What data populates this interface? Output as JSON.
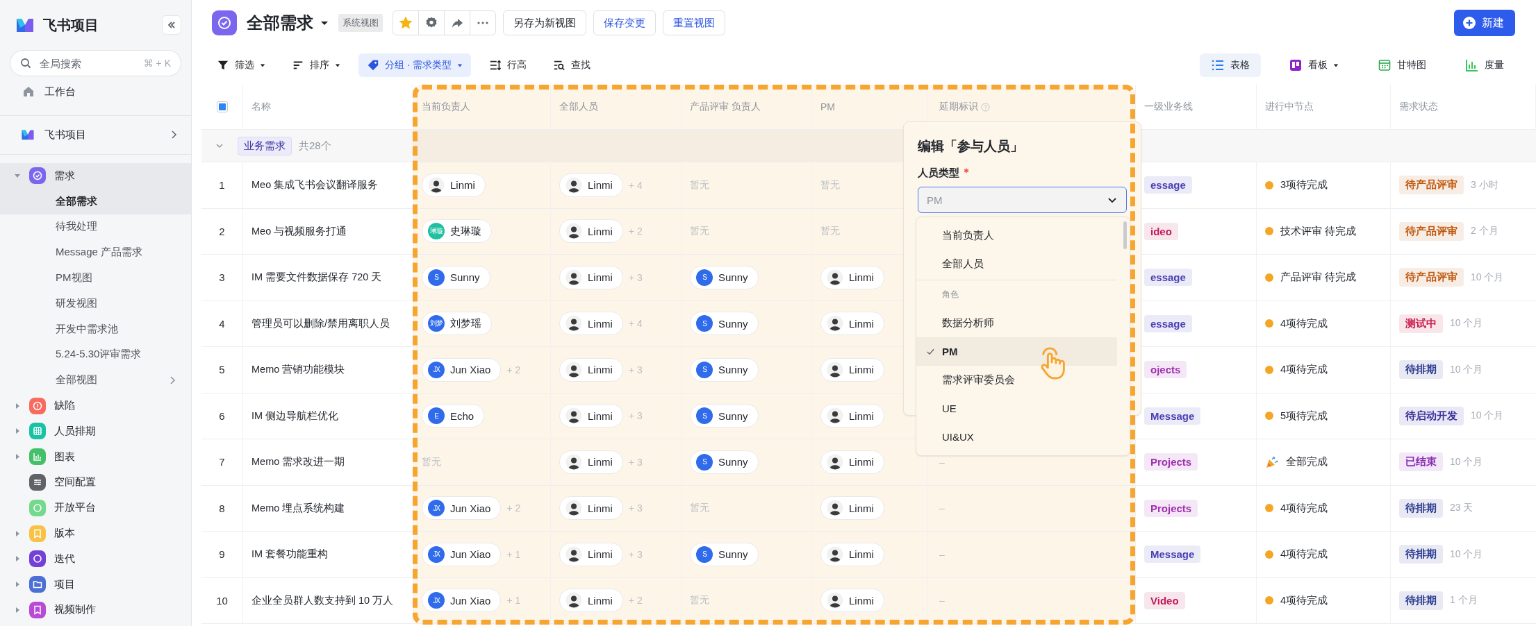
{
  "sidebar": {
    "app_name": "飞书项目",
    "search": {
      "placeholder": "全局搜索",
      "shortcut": "⌘ + K"
    },
    "home": "工作台",
    "space": "飞书项目",
    "nav": [
      {
        "label": "需求",
        "kind": "folder",
        "color": "#7b67ee",
        "expanded": true,
        "selected": true,
        "children": [
          {
            "label": "全部需求",
            "kind": "view",
            "selected": true
          },
          {
            "label": "待我处理",
            "kind": "view",
            "selected": false
          },
          {
            "label": "Message 产品需求",
            "kind": "view",
            "selected": false
          },
          {
            "label": "PM视图",
            "kind": "view",
            "selected": false
          },
          {
            "label": "研发视图",
            "kind": "view",
            "selected": false
          },
          {
            "label": "开发中需求池",
            "kind": "view",
            "selected": false
          },
          {
            "label": "5.24-5.30评审需求",
            "kind": "view",
            "selected": false
          },
          {
            "label": "全部视图",
            "kind": "more",
            "selected": false
          }
        ]
      },
      {
        "label": "缺陷",
        "kind": "folder",
        "color": "#f76c5e",
        "expanded": false,
        "selected": false
      },
      {
        "label": "人员排期",
        "kind": "folder",
        "color": "#19c2a4",
        "expanded": false,
        "selected": false
      },
      {
        "label": "图表",
        "kind": "folder",
        "color": "#45c06a",
        "expanded": false,
        "selected": false
      },
      {
        "label": "空间配置",
        "kind": "page",
        "color": "#5f6368",
        "selected": false
      },
      {
        "label": "开放平台",
        "kind": "page",
        "color": "#74d98c",
        "selected": false
      },
      {
        "label": "版本",
        "kind": "folder",
        "color": "#f7c247",
        "expanded": false,
        "selected": false
      },
      {
        "label": "迭代",
        "kind": "folder",
        "color": "#7440d6",
        "expanded": false,
        "selected": false
      },
      {
        "label": "项目",
        "kind": "folder",
        "color": "#4c6fd6",
        "expanded": false,
        "selected": false
      },
      {
        "label": "视频制作",
        "kind": "folder",
        "color": "#b84ad6",
        "expanded": false,
        "selected": false
      }
    ]
  },
  "header": {
    "title": "全部需求",
    "view_tag": "系统视图",
    "starred": true,
    "buttons": [
      {
        "label": "另存为新视图",
        "kind": "default"
      },
      {
        "label": "保存变更",
        "kind": "link"
      },
      {
        "label": "重置视图",
        "kind": "link"
      }
    ],
    "create": "新建"
  },
  "toolbar": {
    "tools": [
      {
        "label": "筛选",
        "active": false,
        "dropdown": true
      },
      {
        "label": "排序",
        "active": false,
        "dropdown": true
      },
      {
        "label": "分组 · 需求类型",
        "active": true,
        "dropdown": true
      },
      {
        "label": "行高",
        "active": false,
        "dropdown": false
      },
      {
        "label": "查找",
        "active": false,
        "dropdown": false
      }
    ],
    "views": [
      {
        "label": "表格",
        "selected": true,
        "dropdown": false
      },
      {
        "label": "看板",
        "selected": false,
        "dropdown": true
      },
      {
        "label": "甘特图",
        "selected": false,
        "dropdown": false
      },
      {
        "label": "度量",
        "selected": false,
        "dropdown": false
      }
    ]
  },
  "table": {
    "select_all_checked": true,
    "columns": [
      {
        "label": "名称",
        "help": false
      },
      {
        "label": "当前负责人",
        "help": false
      },
      {
        "label": "全部人员",
        "help": false
      },
      {
        "label": "产品评审 负责人",
        "help": false
      },
      {
        "label": "PM",
        "help": false
      },
      {
        "label": "延期标识",
        "help": true
      },
      {
        "label": "一级业务线",
        "help": false
      },
      {
        "label": "进行中节点",
        "help": false
      },
      {
        "label": "需求状态",
        "help": false
      }
    ],
    "group": {
      "label": "业务需求",
      "count": "共28个",
      "expanded": true
    },
    "rows": [
      {
        "index": "1",
        "name": "Meo 集成飞书会议翻译服务",
        "owner": {
          "kind": "person",
          "name": "Linmi",
          "avatar": {
            "kind": "sketch"
          }
        },
        "members": {
          "kind": "person",
          "name": "Linmi",
          "avatar": {
            "kind": "sketch"
          },
          "more": "+ 4"
        },
        "reviewer": {
          "kind": "empty",
          "text": "暂无"
        },
        "pm": {
          "kind": "empty",
          "text": "暂无"
        },
        "line": {
          "label": "essage",
          "color": "#4b3fb5"
        },
        "node": {
          "kind": "pending",
          "text": "3项待完成"
        },
        "status": {
          "label": "待产品评审",
          "color": "#c0580f"
        },
        "age": "3 小时"
      },
      {
        "index": "2",
        "name": "Meo 与视频服务打通",
        "owner": {
          "kind": "person",
          "name": "史琳璇",
          "avatar": {
            "kind": "initials",
            "text": "琳璇",
            "color": "#1fc0a0"
          }
        },
        "members": {
          "kind": "person",
          "name": "Linmi",
          "avatar": {
            "kind": "sketch"
          },
          "more": "+ 2"
        },
        "reviewer": {
          "kind": "empty",
          "text": "暂无"
        },
        "pm": {
          "kind": "empty",
          "text": "暂无"
        },
        "line": {
          "label": "ideo",
          "color": "#c2185b"
        },
        "node": {
          "kind": "pending",
          "text": "技术评审 待完成"
        },
        "status": {
          "label": "待产品评审",
          "color": "#c0580f"
        },
        "age": "2 个月"
      },
      {
        "index": "3",
        "name": "IM 需要文件数据保存 720 天",
        "owner": {
          "kind": "person",
          "name": "Sunny",
          "avatar": {
            "kind": "initials",
            "text": "S",
            "color": "#2f6bea"
          }
        },
        "members": {
          "kind": "person",
          "name": "Linmi",
          "avatar": {
            "kind": "sketch"
          },
          "more": "+ 3"
        },
        "reviewer": {
          "kind": "person",
          "name": "Sunny",
          "avatar": {
            "kind": "initials",
            "text": "S",
            "color": "#2f6bea"
          }
        },
        "pm": {
          "kind": "person",
          "name": "Linmi",
          "avatar": {
            "kind": "sketch"
          }
        },
        "line": {
          "label": "essage",
          "color": "#4b3fb5"
        },
        "node": {
          "kind": "pending",
          "text": "产品评审 待完成"
        },
        "status": {
          "label": "待产品评审",
          "color": "#c0580f"
        },
        "age": "10 个月"
      },
      {
        "index": "4",
        "name": "管理员可以删除/禁用离职人员",
        "owner": {
          "kind": "person",
          "name": "刘梦瑶",
          "avatar": {
            "kind": "initials",
            "text": "刘梦",
            "color": "#2f6bea"
          }
        },
        "members": {
          "kind": "person",
          "name": "Linmi",
          "avatar": {
            "kind": "sketch"
          },
          "more": "+ 4"
        },
        "reviewer": {
          "kind": "person",
          "name": "Sunny",
          "avatar": {
            "kind": "initials",
            "text": "S",
            "color": "#2f6bea"
          }
        },
        "pm": {
          "kind": "person",
          "name": "Linmi",
          "avatar": {
            "kind": "sketch"
          }
        },
        "line": {
          "label": "essage",
          "color": "#4b3fb5"
        },
        "node": {
          "kind": "pending",
          "text": "4项待完成"
        },
        "status": {
          "label": "测试中",
          "color": "#c9184a"
        },
        "age": "10 个月"
      },
      {
        "index": "5",
        "name": "Memo 营销功能模块",
        "owner": {
          "kind": "person",
          "name": "Jun Xiao",
          "avatar": {
            "kind": "initials",
            "text": "JX",
            "color": "#2f6bea"
          },
          "more": "+ 2"
        },
        "members": {
          "kind": "person",
          "name": "Linmi",
          "avatar": {
            "kind": "sketch"
          },
          "more": "+ 3"
        },
        "reviewer": {
          "kind": "person",
          "name": "Sunny",
          "avatar": {
            "kind": "initials",
            "text": "S",
            "color": "#2f6bea"
          }
        },
        "pm": {
          "kind": "person",
          "name": "Linmi",
          "avatar": {
            "kind": "sketch"
          }
        },
        "line": {
          "label": "ojects",
          "color": "#a12fb0"
        },
        "node": {
          "kind": "pending",
          "text": "4项待完成"
        },
        "status": {
          "label": "待排期",
          "color": "#2a3a8f"
        },
        "age": "10 个月"
      },
      {
        "index": "6",
        "name": "IM 侧边导航栏优化",
        "owner": {
          "kind": "person",
          "name": "Echo",
          "avatar": {
            "kind": "initials",
            "text": "E",
            "color": "#2f6bea"
          }
        },
        "members": {
          "kind": "person",
          "name": "Linmi",
          "avatar": {
            "kind": "sketch"
          },
          "more": "+ 3"
        },
        "reviewer": {
          "kind": "person",
          "name": "Sunny",
          "avatar": {
            "kind": "initials",
            "text": "S",
            "color": "#2f6bea"
          }
        },
        "pm": {
          "kind": "person",
          "name": "Linmi",
          "avatar": {
            "kind": "sketch"
          }
        },
        "line": {
          "label": "Message",
          "color": "#4b3fb5"
        },
        "node": {
          "kind": "pending",
          "text": "5项待完成"
        },
        "status": {
          "label": "待启动开发",
          "color": "#3a2f9a"
        },
        "age": "10 个月"
      },
      {
        "index": "7",
        "name": "Memo 需求改进一期",
        "owner": {
          "kind": "empty",
          "text": "暂无"
        },
        "members": {
          "kind": "person",
          "name": "Linmi",
          "avatar": {
            "kind": "sketch"
          },
          "more": "+ 3"
        },
        "reviewer": {
          "kind": "person",
          "name": "Sunny",
          "avatar": {
            "kind": "initials",
            "text": "S",
            "color": "#2f6bea"
          }
        },
        "pm": {
          "kind": "person",
          "name": "Linmi",
          "avatar": {
            "kind": "sketch"
          }
        },
        "delay": "–",
        "line": {
          "label": "Projects",
          "color": "#a12fb0"
        },
        "node": {
          "kind": "done",
          "text": "全部完成"
        },
        "status": {
          "label": "已结束",
          "color": "#8a2bb5"
        },
        "age": "10 个月"
      },
      {
        "index": "8",
        "name": "Memo 埋点系统构建",
        "owner": {
          "kind": "person",
          "name": "Jun Xiao",
          "avatar": {
            "kind": "initials",
            "text": "JX",
            "color": "#2f6bea"
          },
          "more": "+ 2"
        },
        "members": {
          "kind": "person",
          "name": "Linmi",
          "avatar": {
            "kind": "sketch"
          },
          "more": "+ 3"
        },
        "reviewer": {
          "kind": "empty",
          "text": "暂无"
        },
        "pm": {
          "kind": "person",
          "name": "Linmi",
          "avatar": {
            "kind": "sketch"
          }
        },
        "delay": "–",
        "line": {
          "label": "Projects",
          "color": "#a12fb0"
        },
        "node": {
          "kind": "pending",
          "text": "4项待完成"
        },
        "status": {
          "label": "待排期",
          "color": "#2a3a8f"
        },
        "age": "23 天"
      },
      {
        "index": "9",
        "name": "IM 套餐功能重构",
        "owner": {
          "kind": "person",
          "name": "Jun Xiao",
          "avatar": {
            "kind": "initials",
            "text": "JX",
            "color": "#2f6bea"
          },
          "more": "+ 1"
        },
        "members": {
          "kind": "person",
          "name": "Linmi",
          "avatar": {
            "kind": "sketch"
          },
          "more": "+ 3"
        },
        "reviewer": {
          "kind": "person",
          "name": "Sunny",
          "avatar": {
            "kind": "initials",
            "text": "S",
            "color": "#2f6bea"
          }
        },
        "pm": {
          "kind": "person",
          "name": "Linmi",
          "avatar": {
            "kind": "sketch"
          }
        },
        "delay": "–",
        "line": {
          "label": "Message",
          "color": "#4b3fb5"
        },
        "node": {
          "kind": "pending",
          "text": "4项待完成"
        },
        "status": {
          "label": "待排期",
          "color": "#2a3a8f"
        },
        "age": "10 个月"
      },
      {
        "index": "10",
        "name": "企业全员群人数支持到 10 万人",
        "owner": {
          "kind": "person",
          "name": "Jun Xiao",
          "avatar": {
            "kind": "initials",
            "text": "JX",
            "color": "#2f6bea"
          },
          "more": "+ 1"
        },
        "members": {
          "kind": "person",
          "name": "Linmi",
          "avatar": {
            "kind": "sketch"
          },
          "more": "+ 2"
        },
        "reviewer": {
          "kind": "empty",
          "text": "暂无"
        },
        "pm": {
          "kind": "person",
          "name": "Linmi",
          "avatar": {
            "kind": "sketch"
          }
        },
        "delay": "–",
        "line": {
          "label": "Video",
          "color": "#c2185b"
        },
        "node": {
          "kind": "pending",
          "text": "4项待完成"
        },
        "status": {
          "label": "待排期",
          "color": "#2a3a8f"
        },
        "age": "1 个月"
      }
    ]
  },
  "popup": {
    "title": "编辑「参与人员」",
    "field_label": "人员类型",
    "required": true,
    "value": "PM",
    "options": [
      {
        "label": "当前负责人",
        "kind": "option",
        "selected": false
      },
      {
        "label": "全部人员",
        "kind": "option",
        "selected": false
      },
      {
        "label": "角色",
        "kind": "heading"
      },
      {
        "label": "数据分析师",
        "kind": "option",
        "selected": false
      },
      {
        "label": "PM",
        "kind": "option",
        "selected": true
      },
      {
        "label": "需求评审委员会",
        "kind": "option",
        "selected": false
      },
      {
        "label": "UE",
        "kind": "option",
        "selected": false
      },
      {
        "label": "UI&UX",
        "kind": "option",
        "selected": false
      }
    ]
  }
}
